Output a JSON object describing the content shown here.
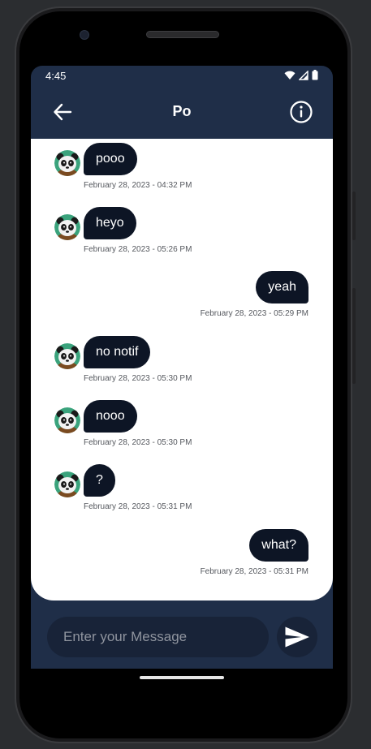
{
  "status_bar": {
    "time": "4:45"
  },
  "header": {
    "title": "Po"
  },
  "messages": [
    {
      "direction": "in",
      "text": "pooo",
      "timestamp": "February 28, 2023 - 04:32 PM"
    },
    {
      "direction": "in",
      "text": "heyo",
      "timestamp": "February 28, 2023 - 05:26 PM"
    },
    {
      "direction": "out",
      "text": "yeah",
      "timestamp": "February 28, 2023 - 05:29 PM"
    },
    {
      "direction": "in",
      "text": "no notif",
      "timestamp": "February 28, 2023 - 05:30 PM"
    },
    {
      "direction": "in",
      "text": "nooo",
      "timestamp": "February 28, 2023 - 05:30 PM"
    },
    {
      "direction": "in",
      "text": "?",
      "timestamp": "February 28, 2023 - 05:31 PM"
    },
    {
      "direction": "out",
      "text": "what?",
      "timestamp": "February 28, 2023 - 05:31 PM"
    }
  ],
  "composer": {
    "placeholder": "Enter your Message"
  },
  "icons": {
    "back": "arrow-left-icon",
    "info": "info-icon",
    "send": "send-icon",
    "avatar": "panda-avatar",
    "wifi": "wifi-icon",
    "signal": "signal-icon",
    "battery": "battery-icon"
  },
  "colors": {
    "header": "#1f2e48",
    "bubble": "#0d1525",
    "chat_background": "#ffffff",
    "input_background": "#182338"
  }
}
